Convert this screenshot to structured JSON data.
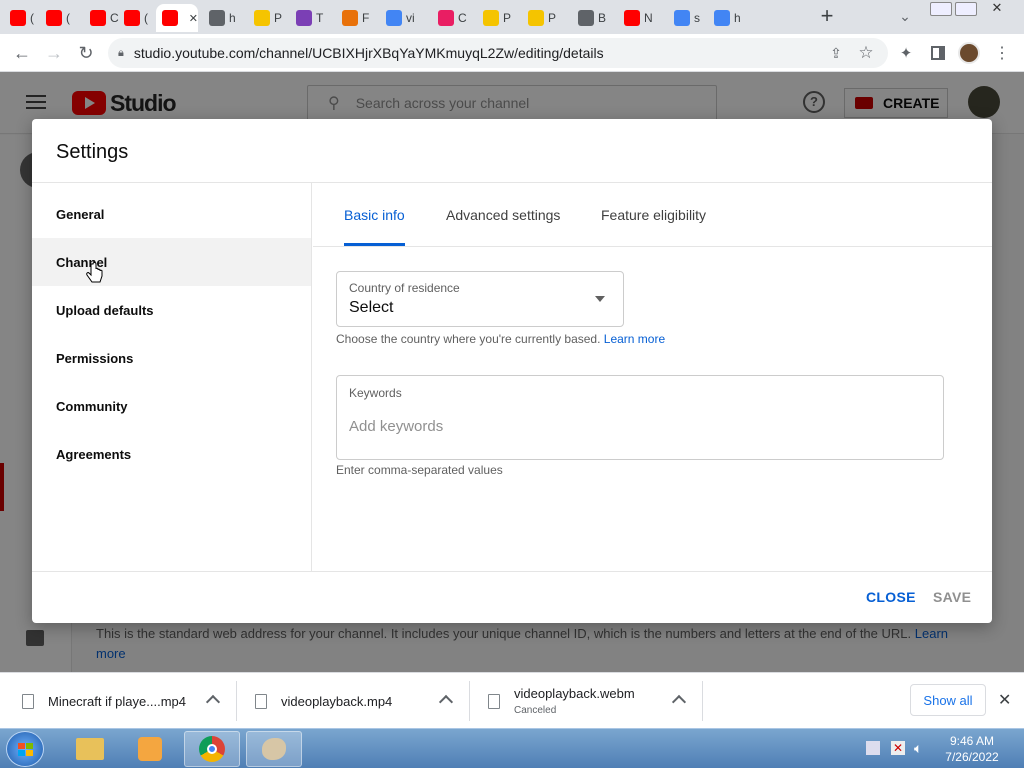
{
  "browser": {
    "tabs": [
      {
        "letter": "(",
        "icon": "youtube-icon",
        "color": "#ff0000"
      },
      {
        "letter": "(",
        "icon": "youtube-icon",
        "color": "#ff0000"
      },
      {
        "letter": "C",
        "icon": "youtube-icon",
        "color": "#ff0000"
      },
      {
        "letter": "(",
        "icon": "youtube-icon",
        "color": "#ff0000"
      },
      {
        "letter": "",
        "icon": "youtube-icon",
        "color": "#ff0000",
        "active": true
      },
      {
        "letter": "h",
        "icon": "globe-icon",
        "color": "#5f6368"
      },
      {
        "letter": "P",
        "icon": "smiley-icon",
        "color": "#f5c400"
      },
      {
        "letter": "T",
        "icon": "t-icon",
        "color": "#7b3fb5"
      },
      {
        "letter": "F",
        "icon": "paint-icon",
        "color": "#e8710a"
      },
      {
        "letter": "vi",
        "icon": "google-icon",
        "color": "#4285f4"
      },
      {
        "letter": "C",
        "icon": "heart-icon",
        "color": "#e91e63"
      },
      {
        "letter": "P",
        "icon": "smiley-icon",
        "color": "#f5c400"
      },
      {
        "letter": "P",
        "icon": "smiley-icon",
        "color": "#f5c400"
      },
      {
        "letter": "B",
        "icon": "globe-icon",
        "color": "#5f6368"
      },
      {
        "letter": "N",
        "icon": "youtube-icon",
        "color": "#ff0000"
      },
      {
        "letter": "s",
        "icon": "google-icon",
        "color": "#4285f4"
      },
      {
        "letter": "h",
        "icon": "google-icon",
        "color": "#4285f4"
      }
    ],
    "url": "studio.youtube.com/channel/UCBIXHjrXBqYaYMKmuyqL2Zw/editing/details"
  },
  "studio": {
    "logo_text": "Studio",
    "search_placeholder": "Search across your channel",
    "create_label": "CREATE",
    "background_text": "This is the standard web address for your channel. It includes your unique channel ID, which is the numbers and letters at the end of the URL.",
    "background_link": "Learn more"
  },
  "dialog": {
    "title": "Settings",
    "nav": [
      {
        "label": "General"
      },
      {
        "label": "Channel",
        "selected": true
      },
      {
        "label": "Upload defaults"
      },
      {
        "label": "Permissions"
      },
      {
        "label": "Community"
      },
      {
        "label": "Agreements"
      }
    ],
    "tabs": [
      {
        "label": "Basic info",
        "selected": true
      },
      {
        "label": "Advanced settings"
      },
      {
        "label": "Feature eligibility"
      }
    ],
    "country": {
      "label": "Country of residence",
      "value": "Select",
      "help": "Choose the country where you're currently based.",
      "learn_more": "Learn more"
    },
    "keywords": {
      "label": "Keywords",
      "placeholder": "Add keywords",
      "help": "Enter comma-separated values"
    },
    "close_label": "CLOSE",
    "save_label": "SAVE"
  },
  "downloads": {
    "items": [
      {
        "name": "Minecraft if playe....mp4",
        "status": ""
      },
      {
        "name": "videoplayback.mp4",
        "status": ""
      },
      {
        "name": "videoplayback.webm",
        "status": "Canceled"
      }
    ],
    "show_all": "Show all"
  },
  "taskbar": {
    "time": "9:46 AM",
    "date": "7/26/2022"
  },
  "colors": {
    "accent": "#065fd4",
    "youtube_red": "#ff0000"
  }
}
